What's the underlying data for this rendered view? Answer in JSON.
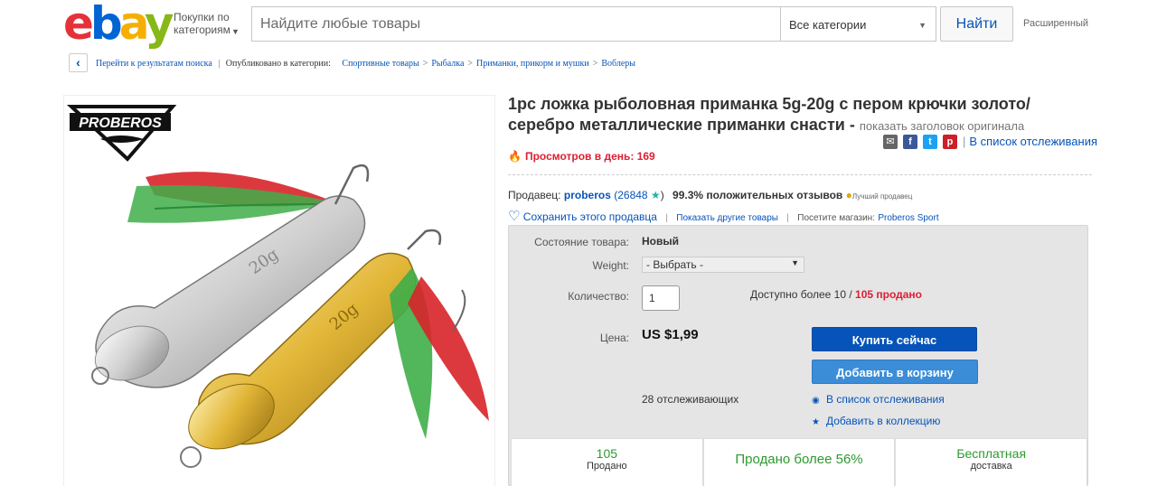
{
  "header": {
    "logo": {
      "e": "e",
      "b": "b",
      "a": "a",
      "y": "y"
    },
    "shop_by_category": "Покупки по категориям",
    "search_placeholder": "Найдите любые товары",
    "category_select": "Все категории",
    "search_button": "Найти",
    "advanced": "Расширенный"
  },
  "breadcrumb": {
    "back": "Перейти к результатам поиска",
    "published_in": "Опубликовано в категории:",
    "items": [
      "Спортивные товары",
      "Рыбалка",
      "Приманки, прикорм и мушки",
      "Воблеры"
    ]
  },
  "image": {
    "brand": "PROBEROS",
    "lure1_text": "20g",
    "lure2_text": "20g",
    "colors": {
      "silver": "#d8d8d8",
      "gold": "#e9c34a",
      "feather_green": "#3fae49",
      "feather_red": "#d8232a"
    }
  },
  "product": {
    "title": "1pc ложка рыболовная приманка 5g-20g с пером крючки золото/серебро металлические приманки снасти -",
    "show_original": "показать заголовок оригинала",
    "watch_link": "В список отслеживания",
    "views": "Просмотров в день: 169"
  },
  "share": {
    "email": "✉",
    "facebook": "f",
    "twitter": "t",
    "pinterest": "p"
  },
  "seller": {
    "label": "Продавец:",
    "name": "proberos",
    "feedback_open": "(26848",
    "feedback_close": ")",
    "positive": "99.3% положительных отзывов",
    "top_rated": "Лучший продавец",
    "save": "Сохранить этого продавца",
    "other_items": "Показать другие товары",
    "visit_store": "Посетите магазин:",
    "store_name": "Proberos Sport"
  },
  "buybox": {
    "condition_label": "Состояние товара:",
    "condition_value": "Новый",
    "weight_label": "Weight:",
    "weight_value": "- Выбрать -",
    "qty_label": "Количество:",
    "qty_value": "1",
    "available": "Доступно более 10 /",
    "sold": "105 продано",
    "price_label": "Цена:",
    "price": "US $1,99",
    "buy_now": "Купить сейчас",
    "add_to_cart": "Добавить в корзину",
    "watchers": "28 отслеживающих",
    "add_watch": "В список отслеживания",
    "add_collection": "Добавить в коллекцию"
  },
  "stats": [
    {
      "big": "105",
      "small": "Продано"
    },
    {
      "big": "Продано более 56%",
      "small": ""
    },
    {
      "big": "Бесплатная",
      "small": "доставка"
    }
  ]
}
